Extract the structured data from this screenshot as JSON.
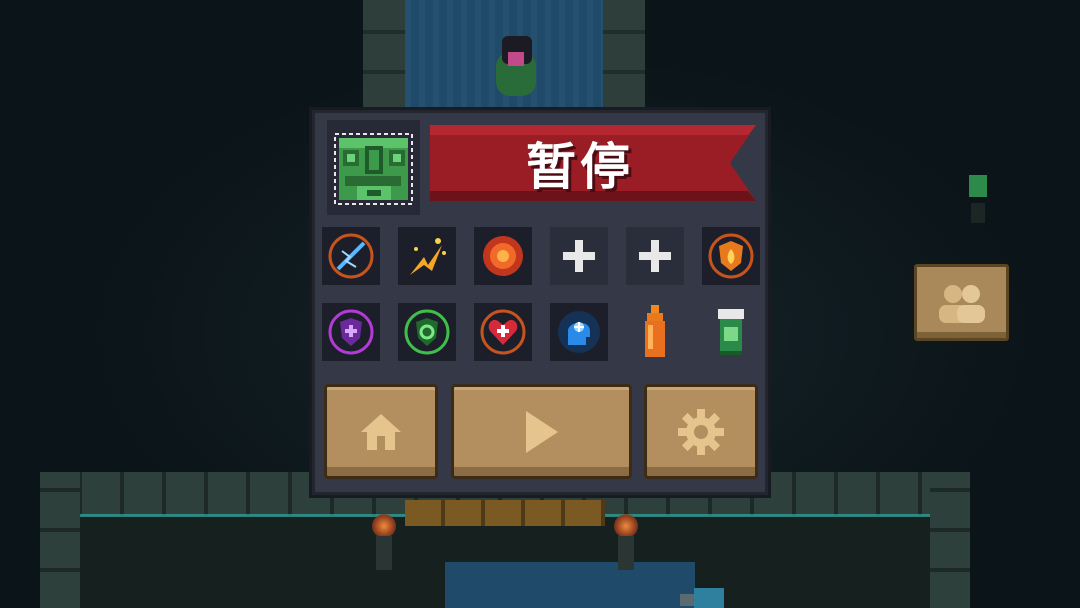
{
  "pause_menu": {
    "title": "暂停"
  },
  "skill_slots": [
    {
      "icon": "lightning-sword-icon",
      "state": "filled"
    },
    {
      "icon": "spark-explosion-icon",
      "state": "filled"
    },
    {
      "icon": "fire-swirl-icon",
      "state": "filled"
    },
    {
      "icon": "plus-icon",
      "state": "empty"
    },
    {
      "icon": "plus-icon",
      "state": "empty"
    },
    {
      "icon": "fire-shield-icon",
      "state": "filled"
    }
  ],
  "buff_slots": [
    {
      "icon": "purple-shield-icon"
    },
    {
      "icon": "green-shield-icon"
    },
    {
      "icon": "heart-plus-icon"
    },
    {
      "icon": "blue-head-icon"
    },
    {
      "icon": "orange-bottle-icon"
    },
    {
      "icon": "green-cup-icon"
    }
  ],
  "buttons": {
    "home": {
      "icon": "home-icon"
    },
    "resume": {
      "icon": "play-icon"
    },
    "settings": {
      "icon": "gear-icon"
    }
  },
  "side": {
    "multiplayer_icon": "people-icon"
  },
  "colors": {
    "banner_red": "#9a1d26",
    "panel": "#353847",
    "button_tan": "#b38f5f"
  }
}
